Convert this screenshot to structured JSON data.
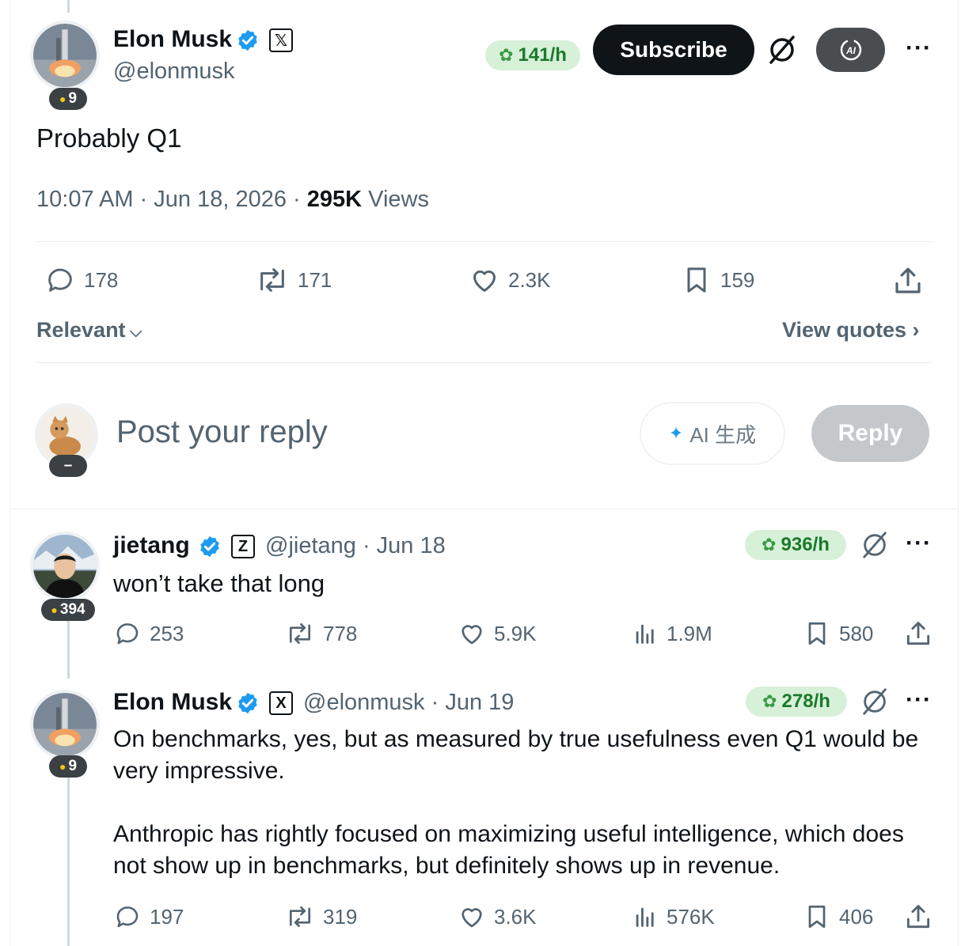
{
  "main_post": {
    "author_name": "Elon Musk",
    "handle": "@elonmusk",
    "level": "9",
    "rate": "141/h",
    "subscribe_label": "Subscribe",
    "text": "Probably Q1",
    "timestamp": "10:07 AM · Jun 18, 2026 · ",
    "views_count": "295K",
    "views_label": " Views",
    "replies": "178",
    "reposts": "171",
    "likes": "2.3K",
    "bookmarks": "159"
  },
  "filter": {
    "sort_label": "Relevant",
    "view_quotes_label": "View quotes"
  },
  "composer": {
    "placeholder": "Post your reply",
    "avatar_level": "–",
    "ai_label": "AI 生成",
    "reply_label": "Reply"
  },
  "replies": [
    {
      "author_name": "jietang",
      "badge": "Z",
      "handle_date": "@jietang · Jun 18",
      "level": "394",
      "rate": "936/h",
      "text": "won’t take that long",
      "replies": "253",
      "reposts": "778",
      "likes": "5.9K",
      "views": "1.9M",
      "bookmarks": "580"
    },
    {
      "author_name": "Elon Musk",
      "badge": "X",
      "handle_date": "@elonmusk · Jun 19",
      "level": "9",
      "rate": "278/h",
      "text_p1_l1": "On benchmarks, yes, but as measured by true usefulness even Q1 would be",
      "text_p1_l2": "very impressive.",
      "text_p2_l1": "Anthropic has rightly focused on maximizing useful intelligence, which does",
      "text_p2_l2": "not show up in benchmarks, but definitely shows up in revenue.",
      "replies": "197",
      "reposts": "319",
      "likes": "3.6K",
      "views": "576K",
      "bookmarks": "406"
    }
  ],
  "icons": {
    "verified": "verified-check-icon",
    "reply": "speech-bubble-icon",
    "repost": "repost-arrows-icon",
    "like": "heart-icon",
    "bookmark": "bookmark-icon",
    "share": "share-upload-icon",
    "views": "bar-chart-icon",
    "grok_off": "slashed-circle-icon",
    "ai": "ai-translate-icon"
  },
  "colors": {
    "verified_blue": "#1d9bf0",
    "rate_bg": "#d7f0d8",
    "rate_text": "#1a7a2c",
    "subscribe_bg": "#0f1419"
  }
}
